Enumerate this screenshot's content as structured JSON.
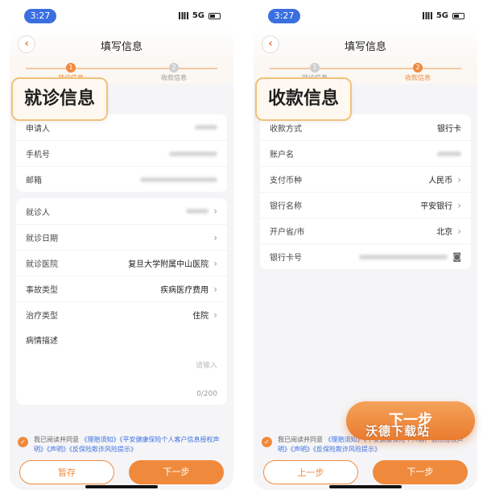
{
  "left": {
    "status": {
      "time": "3:27",
      "network": "5G"
    },
    "nav": {
      "back_icon": "chevron-left-icon",
      "title": "填写信息"
    },
    "steps": [
      {
        "num": "1",
        "label": "就诊信息"
      },
      {
        "num": "2",
        "label": "收款信息"
      }
    ],
    "badge": "就诊信息",
    "card1": {
      "rows": [
        {
          "label": "申请人",
          "value": ""
        },
        {
          "label": "手机号",
          "value": ""
        },
        {
          "label": "邮箱",
          "value": ""
        }
      ]
    },
    "card2": {
      "rows": [
        {
          "label": "就诊人",
          "value": ""
        },
        {
          "label": "就诊日期",
          "value": ""
        },
        {
          "label": "就诊医院",
          "value": "复旦大学附属中山医院"
        },
        {
          "label": "事故类型",
          "value": "疾病医疗费用"
        },
        {
          "label": "治疗类型",
          "value": "住院"
        }
      ],
      "desc_label": "病情描述",
      "desc_placeholder": "请输入",
      "desc_counter": "0/200"
    },
    "agreement": {
      "prefix": "我已阅读并同意",
      "links": "《理赔须知》《平安健康保险个人客户信息授权声明》《声明》《反保险欺诈风险提示》"
    },
    "buttons": {
      "save": "暂存",
      "next": "下一步"
    }
  },
  "right": {
    "status": {
      "time": "3:27",
      "network": "5G"
    },
    "nav": {
      "back_icon": "chevron-left-icon",
      "title": "填写信息"
    },
    "steps": [
      {
        "num": "1",
        "label": "就诊信息"
      },
      {
        "num": "2",
        "label": "收款信息"
      }
    ],
    "badge": "收款信息",
    "card": {
      "rows": [
        {
          "label": "收款方式",
          "value": "银行卡"
        },
        {
          "label": "账户名",
          "value": ""
        },
        {
          "label": "支付币种",
          "value": "人民币"
        },
        {
          "label": "银行名称",
          "value": "平安银行"
        },
        {
          "label": "开户省/市",
          "value": "北京"
        },
        {
          "label": "银行卡号",
          "value": ""
        }
      ]
    },
    "agreement": {
      "prefix": "我已阅读并同意",
      "links": "《理赔须知》《平安健康保险个人客户信息授权声明》《声明》《反保险欺诈风险提示》"
    },
    "buttons": {
      "prev": "上一步",
      "next": "下一步"
    },
    "big_next": "下一步",
    "watermark": "沃德下载站"
  },
  "colors": {
    "accent": "#ef8a3d",
    "link": "#3b6fe0",
    "highlight_border": "#f0c27a"
  }
}
